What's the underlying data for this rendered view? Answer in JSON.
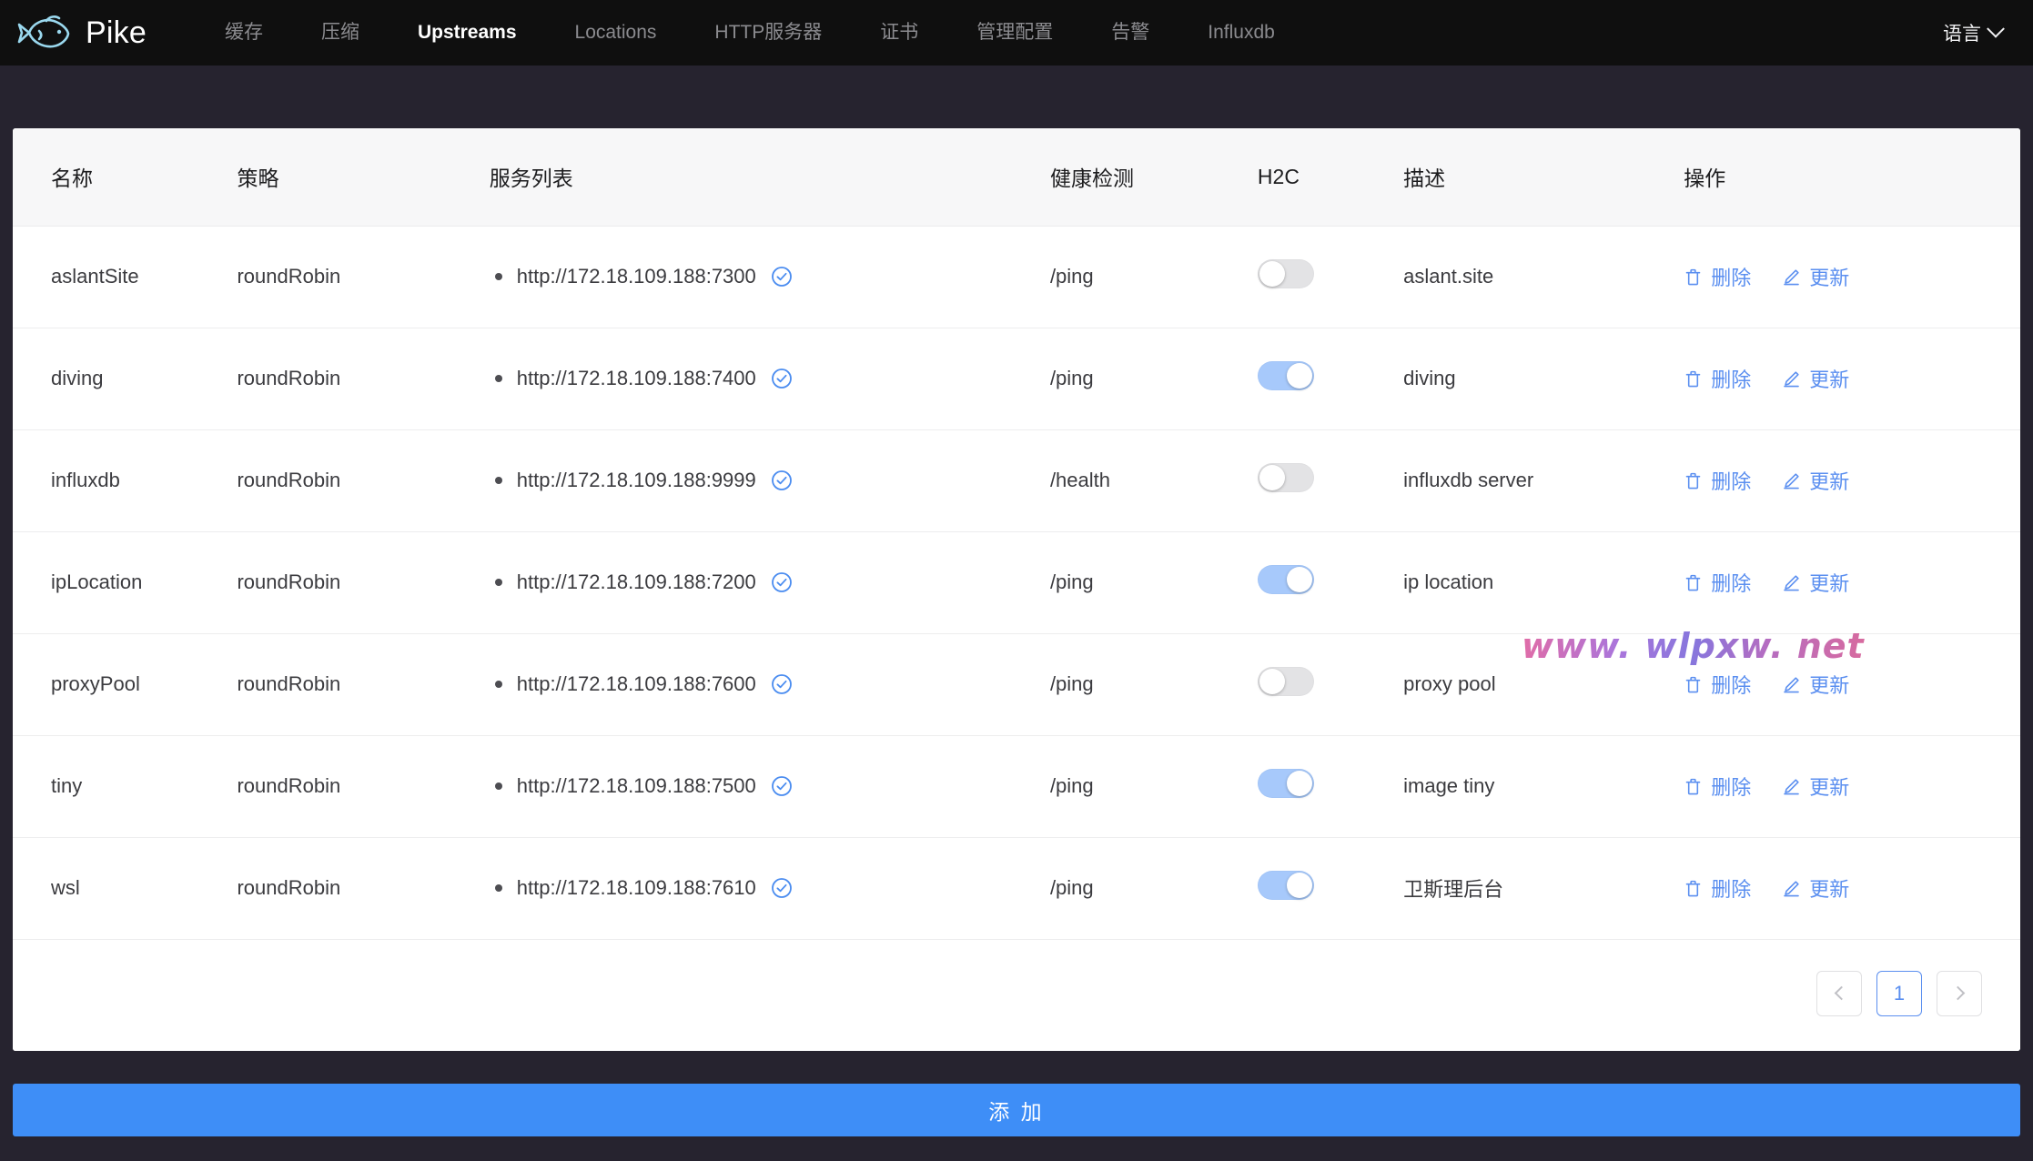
{
  "nav": {
    "brand": "Pike",
    "logo_icon": "fish-icon",
    "items": [
      {
        "label": "缓存",
        "active": false
      },
      {
        "label": "压缩",
        "active": false
      },
      {
        "label": "Upstreams",
        "active": true
      },
      {
        "label": "Locations",
        "active": false
      },
      {
        "label": "HTTP服务器",
        "active": false
      },
      {
        "label": "证书",
        "active": false
      },
      {
        "label": "管理配置",
        "active": false
      },
      {
        "label": "告警",
        "active": false
      },
      {
        "label": "Influxdb",
        "active": false
      }
    ],
    "language_label": "语言",
    "language_icon": "chevron-down-icon"
  },
  "table": {
    "columns": {
      "name": "名称",
      "policy": "策略",
      "services": "服务列表",
      "health": "健康检测",
      "h2c": "H2C",
      "description": "描述",
      "actions": "操作"
    },
    "rows": [
      {
        "name": "aslantSite",
        "policy": "roundRobin",
        "service": "http://172.18.109.188:7300",
        "service_status_icon": "check-circle-icon",
        "health": "/ping",
        "h2c": false,
        "description": "aslant.site"
      },
      {
        "name": "diving",
        "policy": "roundRobin",
        "service": "http://172.18.109.188:7400",
        "service_status_icon": "check-circle-icon",
        "health": "/ping",
        "h2c": true,
        "description": "diving"
      },
      {
        "name": "influxdb",
        "policy": "roundRobin",
        "service": "http://172.18.109.188:9999",
        "service_status_icon": "check-circle-icon",
        "health": "/health",
        "h2c": false,
        "description": "influxdb server"
      },
      {
        "name": "ipLocation",
        "policy": "roundRobin",
        "service": "http://172.18.109.188:7200",
        "service_status_icon": "check-circle-icon",
        "health": "/ping",
        "h2c": true,
        "description": "ip location"
      },
      {
        "name": "proxyPool",
        "policy": "roundRobin",
        "service": "http://172.18.109.188:7600",
        "service_status_icon": "check-circle-icon",
        "health": "/ping",
        "h2c": false,
        "description": "proxy pool"
      },
      {
        "name": "tiny",
        "policy": "roundRobin",
        "service": "http://172.18.109.188:7500",
        "service_status_icon": "check-circle-icon",
        "health": "/ping",
        "h2c": true,
        "description": "image tiny"
      },
      {
        "name": "wsl",
        "policy": "roundRobin",
        "service": "http://172.18.109.188:7610",
        "service_status_icon": "check-circle-icon",
        "health": "/ping",
        "h2c": true,
        "description": "卫斯理后台"
      }
    ],
    "action_labels": {
      "delete": "删除",
      "delete_icon": "trash-icon",
      "update": "更新",
      "update_icon": "pencil-icon"
    }
  },
  "pagination": {
    "prev_icon": "chevron-left-icon",
    "next_icon": "chevron-right-icon",
    "pages": [
      "1"
    ],
    "current": "1"
  },
  "add_button": {
    "label": "添 加"
  },
  "watermark": {
    "text": "www. wlpxw. net"
  },
  "colors": {
    "nav_background": "#0f0f0f",
    "page_background": "#26232f",
    "accent_blue": "#3e8ef7",
    "link_blue": "#5b8ff0",
    "toggle_on": "#a7c9fb",
    "toggle_off": "#e3e3e5",
    "logo_blue": "#9ad8ee"
  }
}
